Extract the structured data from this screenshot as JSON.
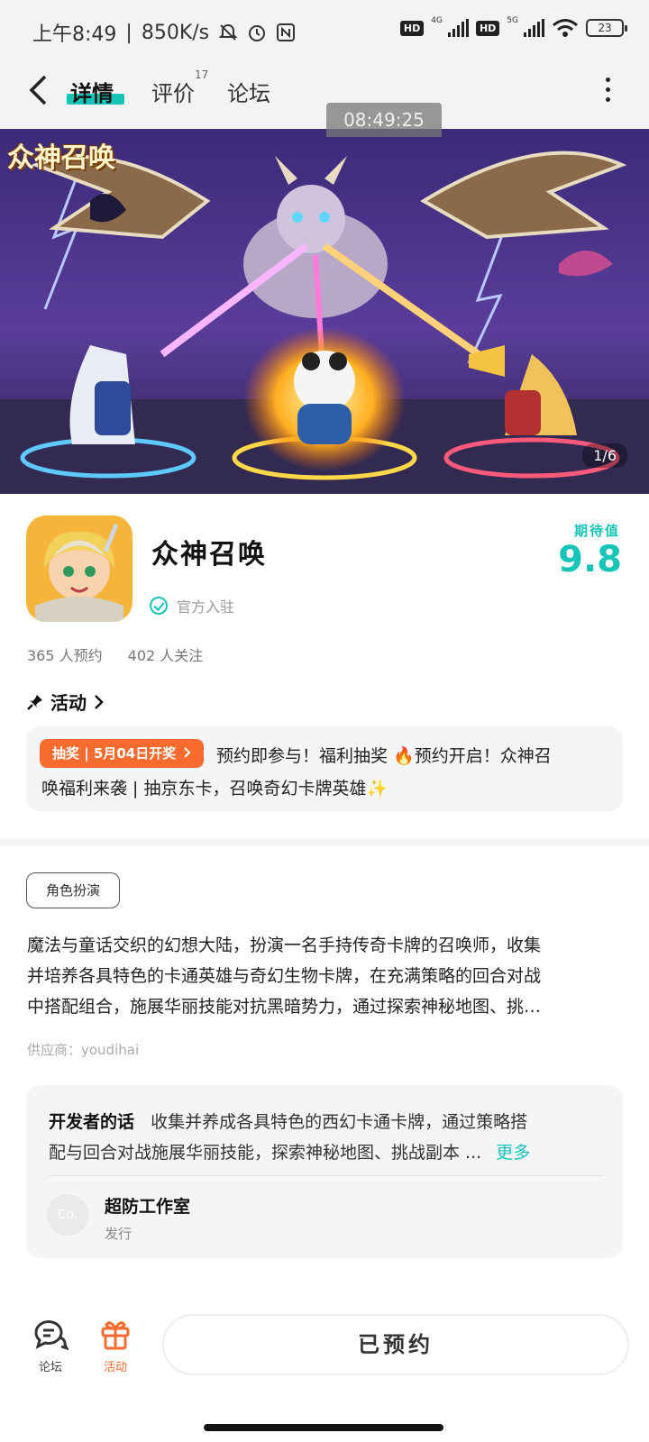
{
  "status_bar": {
    "time": "上午8:49",
    "speed": "850K/s",
    "hd1": "HD",
    "net1": "4G",
    "hd2": "HD",
    "net2": "5G",
    "battery": "23"
  },
  "header": {
    "tabs": [
      {
        "label": "详情",
        "active": true
      },
      {
        "label": "评价",
        "badge": "17"
      },
      {
        "label": "论坛"
      }
    ],
    "time_overlay": "08:49:25"
  },
  "banner": {
    "logo_text": "众神召唤",
    "counter": "1/6"
  },
  "app": {
    "name": "众神召唤",
    "verified_label": "官方入驻",
    "score_label": "期待值",
    "score": "9.8",
    "reservations": "365 人预约",
    "followers": "402 人关注"
  },
  "activity": {
    "title": "活动",
    "pill": "抽奖 | 5月04日开奖",
    "text_line1": "预约即参与！福利抽奖 🔥预约开启！众神召",
    "text_line2": "唤福利来袭 | 抽京东卡，召唤奇幻卡牌英雄✨"
  },
  "details": {
    "genre_tag": "角色扮演",
    "description_lines": [
      "魔法与童话交织的幻想大陆，扮演一名手持传奇卡牌的召唤师，收集",
      "并培养各具特色的卡通英雄与奇幻生物卡牌，在充满策略的回合对战",
      "中搭配组合，施展华丽技能对抗黑暗势力，通过探索神秘地图、挑…"
    ],
    "supplier": "供应商：youdihai"
  },
  "developer": {
    "heading": "开发者的话",
    "line1": "收集并养成各具特色的西幻卡通卡牌，通过策略搭",
    "line2": "配与回合对战施展华丽技能，探索神秘地图、挑战副本 ...",
    "more": "更多",
    "avatar_text": "Co.",
    "studio": "超防工作室",
    "role": "发行"
  },
  "bottom_bar": {
    "forum_label": "论坛",
    "activity_label": "活动",
    "reserve_label": "已预约"
  },
  "colors": {
    "accent": "#16c5b6",
    "orange": "#f86b2f",
    "card_bg": "#f4f5f7"
  }
}
